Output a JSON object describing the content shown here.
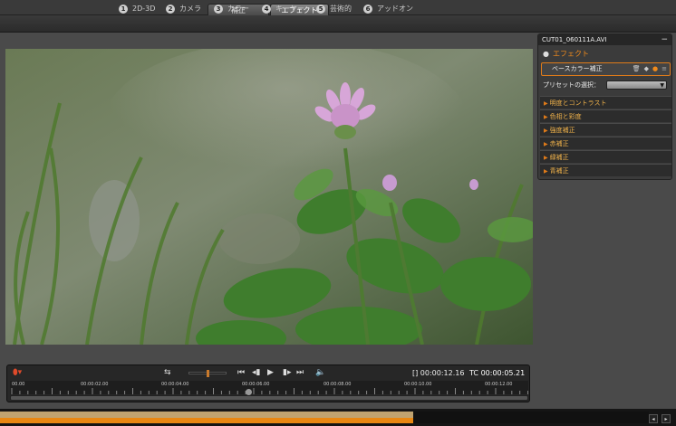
{
  "modes": {
    "correction": "補正",
    "effect": "エフェクト"
  },
  "steps": [
    {
      "num": "1",
      "label": "2D-3D"
    },
    {
      "num": "2",
      "label": "カメラ"
    },
    {
      "num": "3",
      "label": "カラー"
    },
    {
      "num": "4",
      "label": "キーヤー"
    },
    {
      "num": "5",
      "label": "芸術的"
    },
    {
      "num": "6",
      "label": "アッドオン"
    }
  ],
  "panel": {
    "file_name": "CUT01_060111A.AVI",
    "minimize": "−",
    "effect_label": "エフェクト",
    "base_color": "ベースカラー補正",
    "preset_label": "プリセットの選択：",
    "preset_value": "",
    "sections": [
      "明度とコントラスト",
      "色相と彩度",
      "強度補正",
      "赤補正",
      "緑補正",
      "青補正"
    ]
  },
  "transport": {
    "timecode_duration": "00:00:12.16",
    "timecode_prefix": "TC",
    "timecode_current": "00:00:05.21",
    "ruler_labels": [
      "00.00",
      "00:00:02.00",
      "00:00:04.00",
      "00:00:06.00",
      "00:00:08.00",
      "00:00:10.00",
      "00:00:12.00"
    ],
    "playhead_position": 0.46
  },
  "colors": {
    "accent": "#e07b19",
    "section_text": "#f0b24a"
  }
}
